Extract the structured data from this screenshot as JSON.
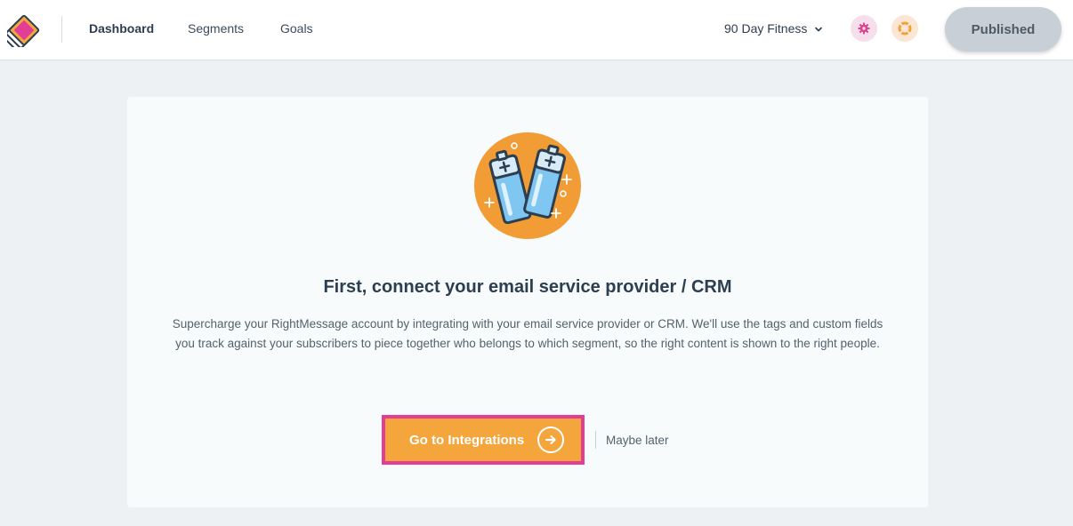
{
  "nav": {
    "items": [
      {
        "label": "Dashboard",
        "active": true
      },
      {
        "label": "Segments",
        "active": false
      },
      {
        "label": "Goals",
        "active": false
      }
    ],
    "project_label": "90 Day Fitness",
    "publish_label": "Published"
  },
  "icons": {
    "logo": "rightmessage-logo-icon",
    "project_dropdown": "chevron-down-icon",
    "settings": "gear-icon",
    "help": "lifebuoy-icon",
    "illustration": "batteries-icon",
    "cta": "arrow-right-icon"
  },
  "colors": {
    "accent": "#f4a53c",
    "highlight_outline": "#e23d97",
    "settings_icon": "#e0418f",
    "help_icon": "#f0a23c",
    "publish_bg": "#c8cfd7"
  },
  "main": {
    "title": "First, connect your email service provider / CRM",
    "description": "Supercharge your RightMessage account by integrating with your email service provider or CRM. We'll use the tags and custom fields you track against your subscribers to piece together who belongs to which segment, so the right content is shown to the right people.",
    "cta_label": "Go to Integrations",
    "secondary_label": "Maybe later"
  }
}
